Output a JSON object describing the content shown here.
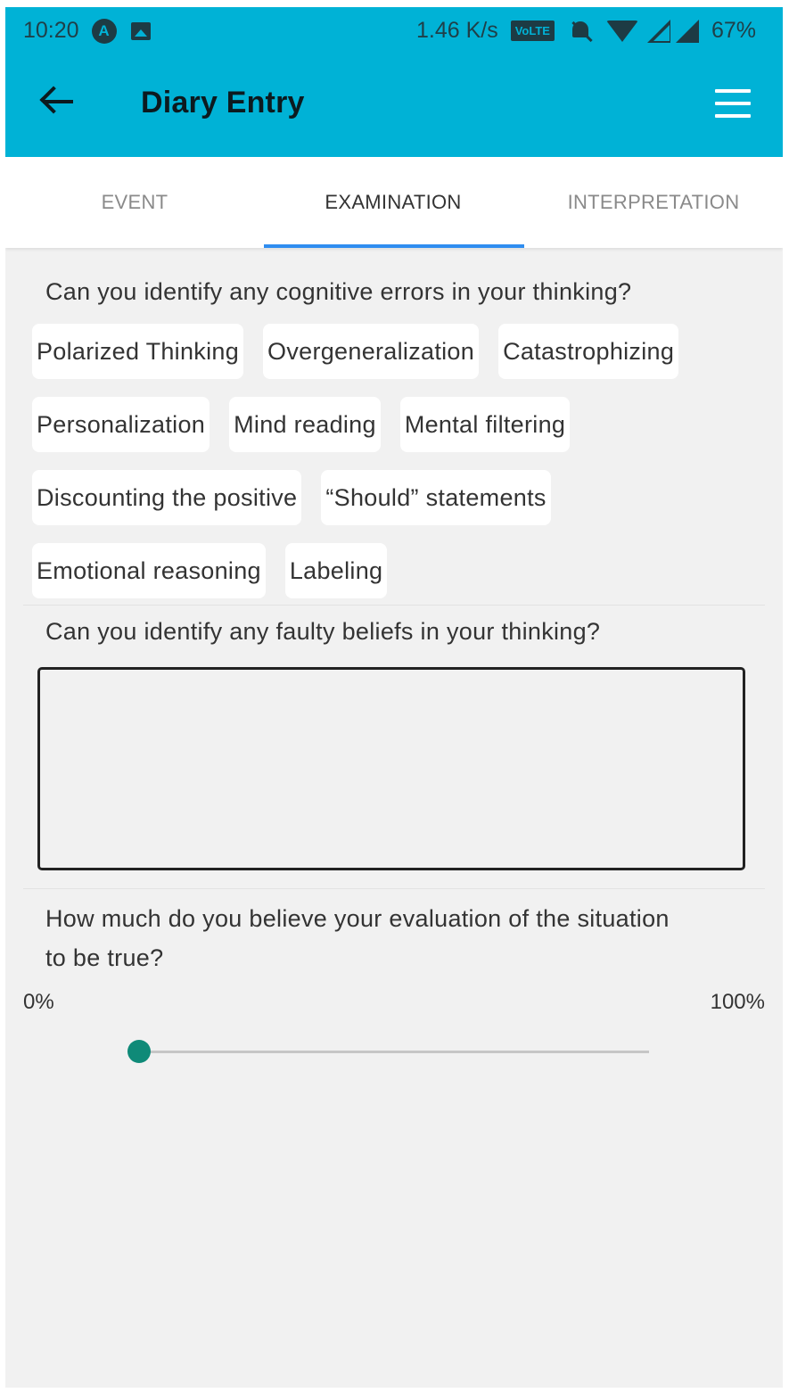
{
  "status_bar": {
    "time": "10:20",
    "speed": "1.46 K/s",
    "network_badge": "VoLTE",
    "battery": "67%",
    "icons": [
      "a-circle-icon",
      "image-icon",
      "bell-off-icon",
      "wifi-icon",
      "signal-icon",
      "signal-full-icon"
    ]
  },
  "header": {
    "title": "Diary Entry",
    "background_color": "#00b2d6"
  },
  "tabs": [
    {
      "label": "EVENT",
      "selected": false
    },
    {
      "label": "EXAMINATION",
      "selected": true
    },
    {
      "label": "INTERPRETATION",
      "selected": false
    }
  ],
  "cognitive_errors": {
    "question": "Can you identify any cognitive errors in your thinking?",
    "chips": [
      [
        "Polarized Thinking",
        "Overgeneralization",
        "Catastrophizing"
      ],
      [
        "Personalization",
        "Mind reading",
        "Mental filtering"
      ],
      [
        "Discounting the positive",
        "“Should” statements"
      ],
      [
        "Emotional reasoning",
        "Labeling"
      ]
    ]
  },
  "faulty_beliefs": {
    "question": "Can you identify any faulty beliefs in your thinking?",
    "value": ""
  },
  "belief_rating": {
    "question": "How much do you believe your evaluation of the situation to be true?",
    "min_label": "0%",
    "max_label": "100%",
    "value": 0,
    "accent_color": "#0f8a78"
  }
}
